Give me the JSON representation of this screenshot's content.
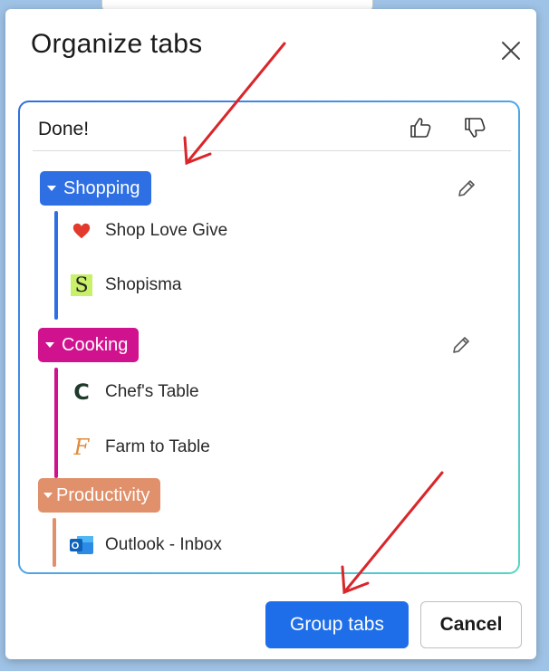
{
  "dialog": {
    "title": "Organize tabs",
    "status": "Done!"
  },
  "groups": [
    {
      "label": "Shopping",
      "color": "#2f6fe4",
      "tabs": [
        {
          "title": "Shop Love Give",
          "icon": "heart-icon"
        },
        {
          "title": "Shopisma",
          "icon": "letter-s-icon"
        }
      ]
    },
    {
      "label": "Cooking",
      "color": "#d1128e",
      "tabs": [
        {
          "title": "Chef's Table",
          "icon": "letter-c-icon"
        },
        {
          "title": "Farm to Table",
          "icon": "letter-f-icon"
        }
      ]
    },
    {
      "label": "Productivity",
      "color": "#e0906a",
      "tabs": [
        {
          "title": "Outlook - Inbox",
          "icon": "outlook-icon"
        }
      ]
    }
  ],
  "icon_glyphs": {
    "shopisma": "S",
    "chefs_table": "C",
    "farm_to_table": "F",
    "outlook": "O"
  },
  "buttons": {
    "group_tabs": "Group tabs",
    "cancel": "Cancel"
  },
  "colors": {
    "primary": "#1d6ee8",
    "annotation_arrow": "#d9262a"
  }
}
